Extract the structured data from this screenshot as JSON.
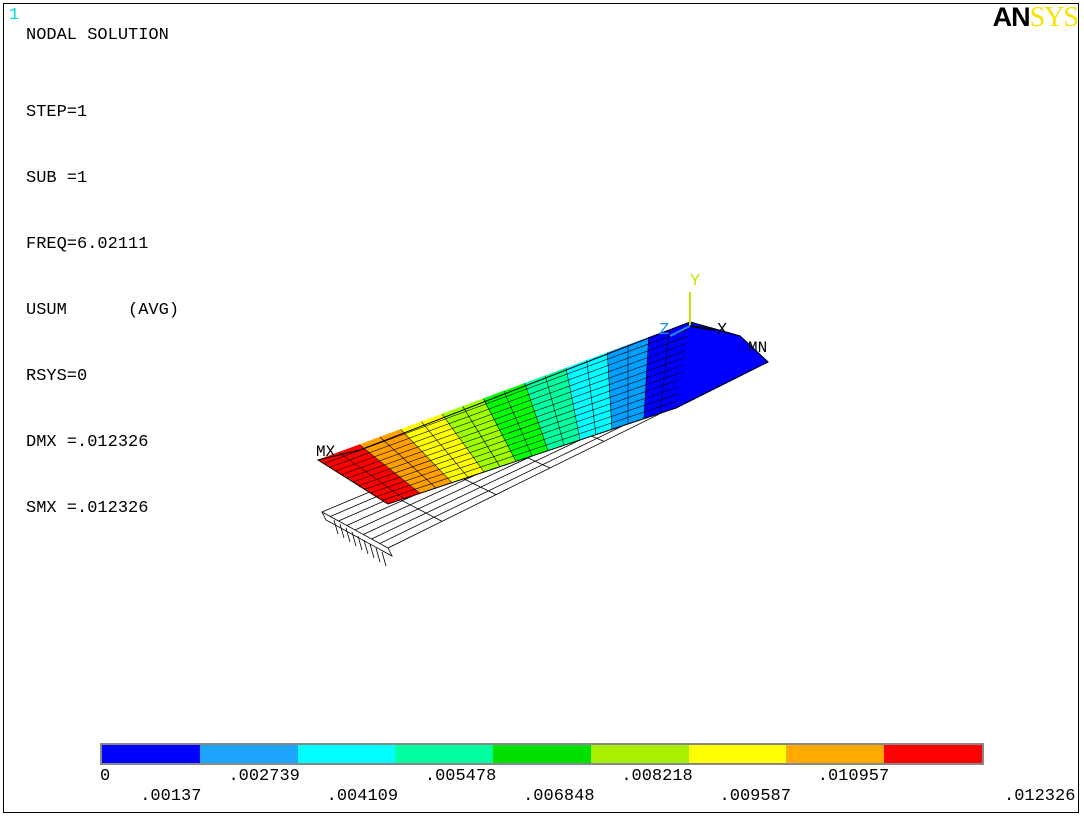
{
  "window": {
    "number": "1",
    "title": "NODAL SOLUTION"
  },
  "info_lines": [
    "STEP=1",
    "SUB =1",
    "FREQ=6.02111",
    "USUM      (AVG)",
    "RSYS=0",
    "DMX =.012326",
    "SMX =.012326"
  ],
  "logo": {
    "part1": "AN",
    "part2": "SYS"
  },
  "triad": {
    "x": "X",
    "y": "Y",
    "z": "Z"
  },
  "markers": {
    "max": "MX",
    "min": "MN"
  },
  "contour_colors": [
    "#0000ff",
    "#00a0ff",
    "#00ffff",
    "#00ffa0",
    "#00ff00",
    "#a0ff00",
    "#ffff00",
    "#ffa000",
    "#ff0000"
  ],
  "legend": {
    "colors": [
      "#0000ff",
      "#1ea5ff",
      "#00ffff",
      "#00ffa0",
      "#00e000",
      "#a8f000",
      "#ffff00",
      "#ffaa00",
      "#ff0000"
    ],
    "values_top": [
      "0",
      ".002739",
      ".005478",
      ".008218",
      ".010957"
    ],
    "values_bottom": [
      ".00137",
      ".004109",
      ".006848",
      ".009587",
      ".012326"
    ]
  },
  "accent_colors": {
    "window_number": "#00d8d8",
    "triad_y": "#c8e000",
    "triad_z": "#1e90ff",
    "logo_sys": "#f5e600"
  }
}
